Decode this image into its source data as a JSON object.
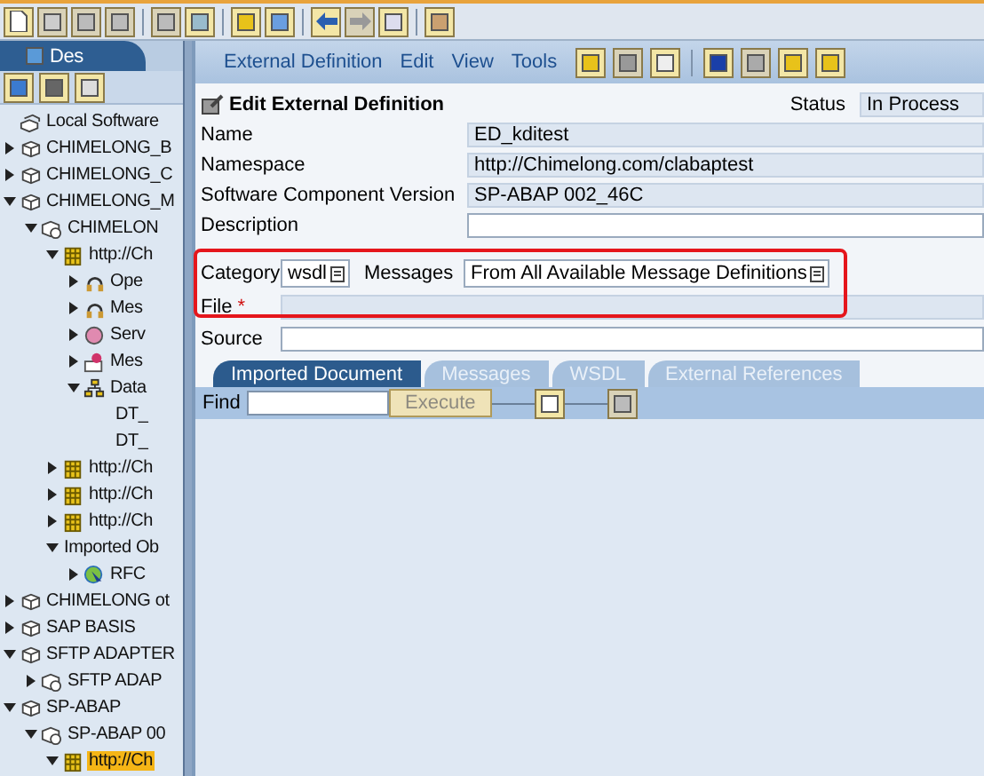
{
  "left_pane": {
    "tab": "Des",
    "tree": [
      {
        "label": "Local Software",
        "kind": "local",
        "selected": false
      },
      {
        "label": "CHIMELONG_B",
        "kind": "product",
        "expanded": false,
        "selected": false
      },
      {
        "label": "CHIMELONG_C",
        "kind": "product",
        "expanded": false,
        "selected": false
      },
      {
        "label": "CHIMELONG_M",
        "kind": "product",
        "expanded": true,
        "selected": false,
        "children": [
          {
            "label": "CHIMELON",
            "kind": "version",
            "expanded": true,
            "selected": false,
            "children": [
              {
                "label": "http://Ch",
                "kind": "namespace",
                "expanded": true,
                "selected": false,
                "children": [
                  {
                    "label": "Ope",
                    "kind": "interface",
                    "expanded": false,
                    "selected": false
                  },
                  {
                    "label": "Mes",
                    "kind": "interface",
                    "expanded": false,
                    "selected": false
                  },
                  {
                    "label": "Serv",
                    "kind": "service",
                    "expanded": false,
                    "selected": false
                  },
                  {
                    "label": "Mes",
                    "kind": "message",
                    "expanded": false,
                    "selected": false
                  },
                  {
                    "label": "Data",
                    "kind": "datatype",
                    "expanded": true,
                    "selected": false,
                    "children": [
                      {
                        "label": "DT_",
                        "kind": "leaf",
                        "selected": false
                      },
                      {
                        "label": "DT_",
                        "kind": "leaf",
                        "selected": false
                      }
                    ]
                  }
                ]
              },
              {
                "label": "http://Ch",
                "kind": "namespace",
                "expanded": false,
                "selected": false
              },
              {
                "label": "http://Ch",
                "kind": "namespace",
                "expanded": false,
                "selected": false
              },
              {
                "label": "http://Ch",
                "kind": "namespace",
                "expanded": false,
                "selected": false
              },
              {
                "label": "Imported Ob",
                "kind": "none",
                "expanded": true,
                "selected": false,
                "children": [
                  {
                    "label": "RFC",
                    "kind": "rfc",
                    "expanded": false,
                    "selected": false
                  }
                ]
              }
            ]
          }
        ]
      },
      {
        "label": "CHIMELONG ot",
        "kind": "product",
        "expanded": false,
        "selected": false
      },
      {
        "label": "SAP BASIS",
        "kind": "product",
        "expanded": false,
        "selected": false
      },
      {
        "label": "SFTP ADAPTER",
        "kind": "product",
        "expanded": true,
        "selected": false,
        "children": [
          {
            "label": "SFTP ADAP",
            "kind": "version",
            "expanded": false,
            "selected": false
          }
        ]
      },
      {
        "label": "SP-ABAP",
        "kind": "product",
        "expanded": true,
        "selected": false,
        "children": [
          {
            "label": "SP-ABAP 00",
            "kind": "version",
            "expanded": true,
            "selected": false,
            "children": [
              {
                "label": "http://Ch",
                "kind": "namespace",
                "expanded": true,
                "selected": true
              }
            ]
          }
        ]
      }
    ]
  },
  "menu": [
    {
      "label": "External Definition"
    },
    {
      "label": "Edit"
    },
    {
      "label": "View"
    },
    {
      "label": "Tools"
    }
  ],
  "form": {
    "title": "Edit External Definition",
    "status_label": "Status",
    "status": "In Process",
    "fields": [
      {
        "label": "Name",
        "value": "ED_kditest",
        "kind": "readonly"
      },
      {
        "label": "Namespace",
        "value": "http://Chimelong.com/clabaptest",
        "kind": "readonly"
      },
      {
        "label": "Software Component Version",
        "value": "SP-ABAP 002_46C",
        "kind": "readonly"
      },
      {
        "label": "Description",
        "kind": "input"
      }
    ],
    "category": {
      "label": "Category",
      "value": "wsdl"
    },
    "messages": {
      "label": "Messages",
      "value": "From All Available Message Definitions"
    },
    "file": {
      "label": "File",
      "required_mark": "*"
    },
    "source": {
      "label": "Source"
    }
  },
  "tabs": [
    {
      "label": "Imported Document",
      "selected": true
    },
    {
      "label": "Messages",
      "selected": false
    },
    {
      "label": "WSDL",
      "selected": false
    },
    {
      "label": "External References",
      "selected": false
    }
  ],
  "find": {
    "label": "Find",
    "button": "Execute"
  }
}
